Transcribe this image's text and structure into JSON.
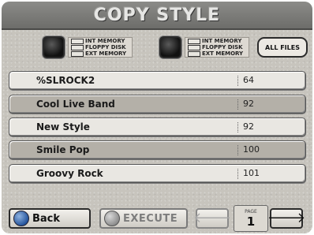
{
  "title": "COPY STYLE",
  "source_left": {
    "options": [
      "INT MEMORY",
      "FLOPPY DISK",
      "EXT MEMORY"
    ]
  },
  "source_right": {
    "options": [
      "INT MEMORY",
      "FLOPPY DISK",
      "EXT MEMORY"
    ]
  },
  "all_files_label": "ALL FILES",
  "styles": [
    {
      "name": "%SLROCK2",
      "tempo": "64"
    },
    {
      "name": "Cool Live Band",
      "tempo": "92"
    },
    {
      "name": "New Style",
      "tempo": "92"
    },
    {
      "name": "Smile Pop",
      "tempo": "100"
    },
    {
      "name": "Groovy Rock",
      "tempo": "101"
    }
  ],
  "footer": {
    "back_label": "Back",
    "execute_label": "EXECUTE",
    "prev_icon": "arrow-left-icon",
    "next_icon": "arrow-right-icon",
    "page_label": "PAGE",
    "page_number": "1"
  }
}
